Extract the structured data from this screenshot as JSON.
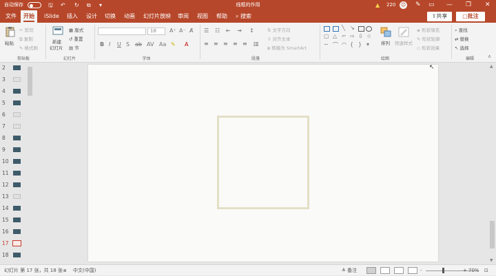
{
  "titlebar": {
    "autosave": "自动保存",
    "autosave_state": "●",
    "title": "线框的作用",
    "warning_count": "220",
    "pen_icon": "✎",
    "minimize": "—",
    "maximize": "❐",
    "close": "✕"
  },
  "tabs": {
    "items": [
      "文件",
      "开始",
      "iSlide",
      "插入",
      "设计",
      "切换",
      "动画",
      "幻灯片放映",
      "审阅",
      "视图",
      "帮助"
    ],
    "active_index": 1,
    "search": "搜索",
    "share": "共享",
    "comment": "批注"
  },
  "ribbon": {
    "clipboard": {
      "paste": "粘贴",
      "cut": "剪切",
      "copy": "复制",
      "format_painter": "格式刷",
      "label": "剪贴板"
    },
    "slides": {
      "new_slide_l1": "新建",
      "new_slide_l2": "幻灯片",
      "layout": "版式",
      "reset": "重置",
      "section": "节",
      "label": "幻灯片"
    },
    "font": {
      "size": "18",
      "label": "字体"
    },
    "paragraph": {
      "text_direction": "文字方向",
      "align_text": "对齐文本",
      "smartart": "转换为 SmartArt",
      "label": "段落"
    },
    "drawing": {
      "arrange": "排列",
      "quick_styles": "快速样式",
      "shape_fill": "形状填充",
      "shape_outline": "形状轮廓",
      "shape_effects": "形状效果",
      "label": "绘图"
    },
    "editing": {
      "find": "查找",
      "replace": "替换",
      "select": "选择",
      "label": "编辑"
    }
  },
  "thumbnails": [
    {
      "num": "2",
      "style": "dark"
    },
    {
      "num": "3",
      "style": "light"
    },
    {
      "num": "4",
      "style": "dark"
    },
    {
      "num": "5",
      "style": "dark"
    },
    {
      "num": "6",
      "style": "light"
    },
    {
      "num": "7",
      "style": "light"
    },
    {
      "num": "8",
      "style": "dark"
    },
    {
      "num": "9",
      "style": "dark"
    },
    {
      "num": "10",
      "style": "dark"
    },
    {
      "num": "11",
      "style": "dark"
    },
    {
      "num": "12",
      "style": "dark"
    },
    {
      "num": "13",
      "style": "light"
    },
    {
      "num": "14",
      "style": "dark"
    },
    {
      "num": "15",
      "style": "dark"
    },
    {
      "num": "16",
      "style": "dark"
    },
    {
      "num": "17",
      "style": "selected"
    },
    {
      "num": "18",
      "style": "dark"
    }
  ],
  "statusbar": {
    "slide_info": "幻灯片 第 17 张，共 18 张",
    "language": "中文(中国)",
    "notes": "备注",
    "zoom_minus": "-",
    "zoom_plus": "+",
    "zoom": "70%",
    "zoom_fraction": 0.7
  },
  "colors": {
    "accent": "#b7472a",
    "frame": "#e3dfc6"
  }
}
